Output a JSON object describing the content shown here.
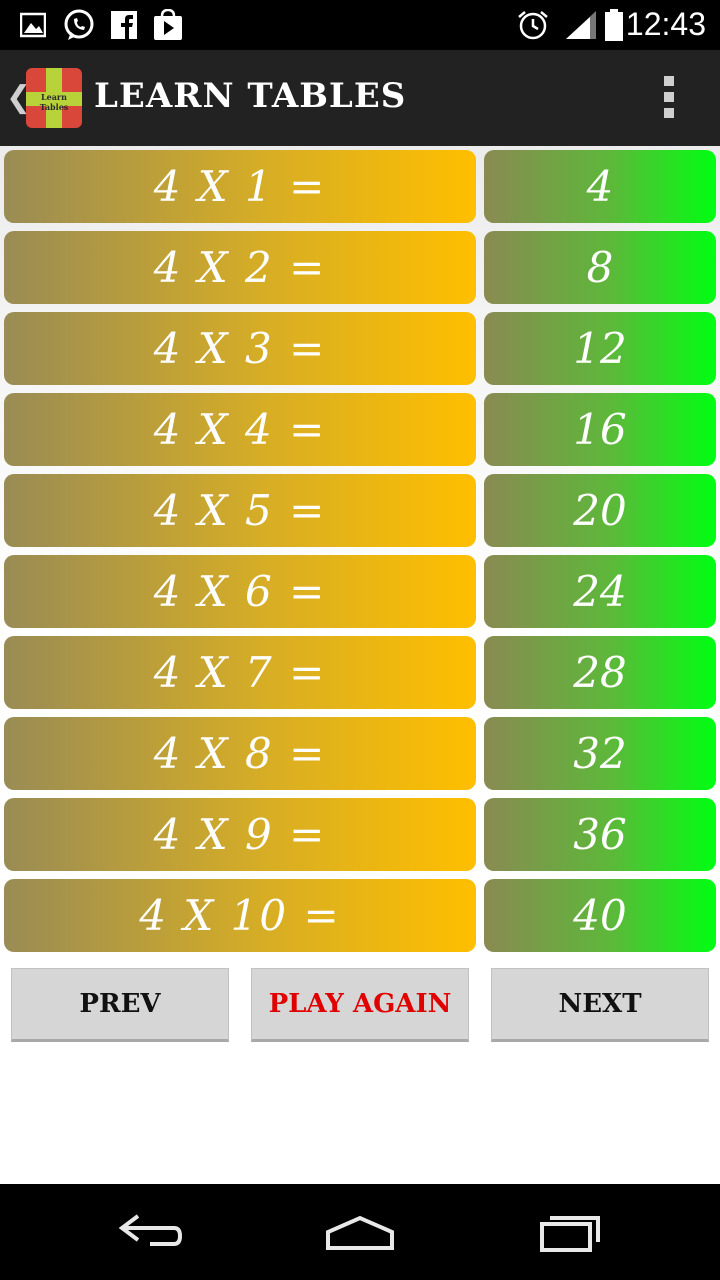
{
  "status_bar": {
    "time": "12:43",
    "left_icons": [
      "gallery-icon",
      "whatsapp-icon",
      "facebook-icon",
      "play-store-icon"
    ],
    "right_icons": [
      "alarm-icon",
      "signal-icon",
      "battery-icon"
    ]
  },
  "action_bar": {
    "title": "LEARN TABLES",
    "logo_text": "Learn Tables"
  },
  "rows": [
    {
      "expr": "4 X 1 =",
      "ans": "4"
    },
    {
      "expr": "4 X 2 =",
      "ans": "8"
    },
    {
      "expr": "4 X 3 =",
      "ans": "12"
    },
    {
      "expr": "4 X 4 =",
      "ans": "16"
    },
    {
      "expr": "4 X 5 =",
      "ans": "20"
    },
    {
      "expr": "4 X 6 =",
      "ans": "24"
    },
    {
      "expr": "4 X 7 =",
      "ans": "28"
    },
    {
      "expr": "4 X 8 =",
      "ans": "32"
    },
    {
      "expr": "4 X 9 =",
      "ans": "36"
    },
    {
      "expr": "4 X 10 =",
      "ans": "40"
    }
  ],
  "buttons": {
    "prev": "PREV",
    "play_again": "PLAY AGAIN",
    "next": "NEXT"
  },
  "colors": {
    "play_again_text": "#e00000",
    "expr_gradient_end": "#ffbf00",
    "ans_gradient_end": "#00ff12"
  }
}
